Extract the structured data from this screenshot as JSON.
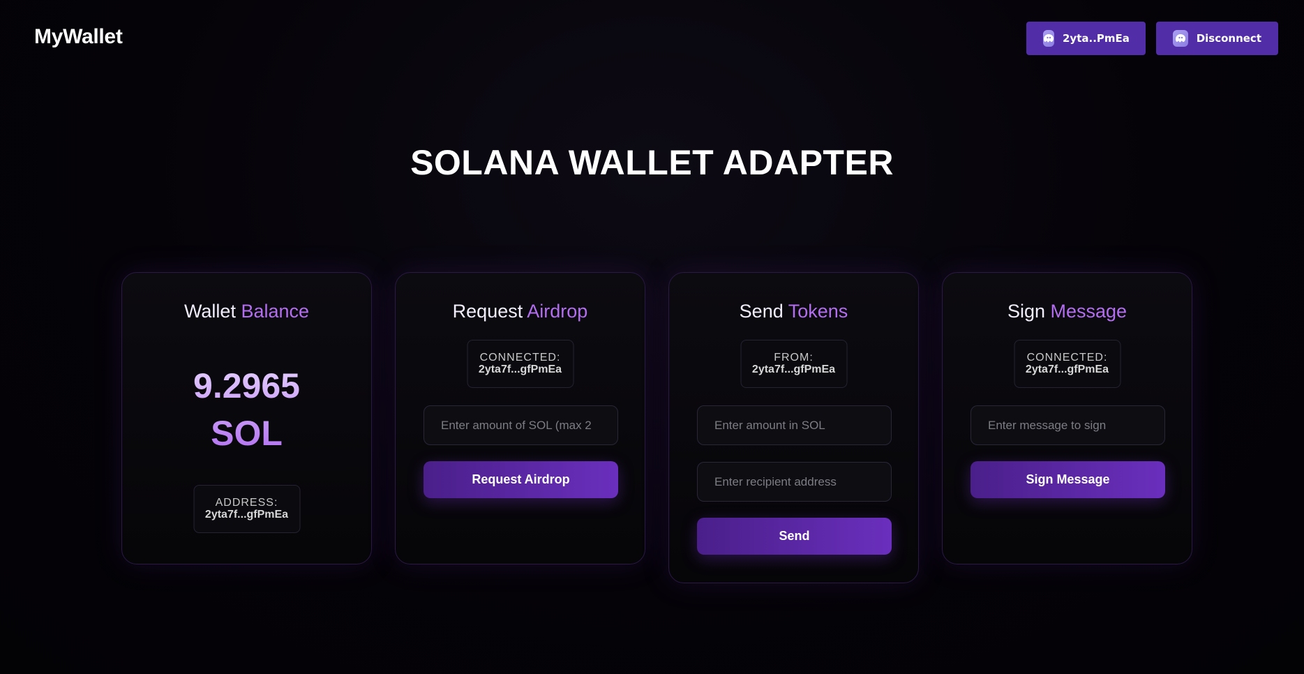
{
  "navbar": {
    "brand": "MyWallet",
    "address_button": "2yta..PmEa",
    "disconnect_button": "Disconnect"
  },
  "hero": {
    "title": "SOLANA WALLET ADAPTER"
  },
  "cards": {
    "balance": {
      "title_main": "Wallet",
      "title_accent": "Balance",
      "amount": "9.2965",
      "unit": "SOL",
      "chip_label": "ADDRESS:",
      "chip_value": "2yta7f...gfPmEa"
    },
    "airdrop": {
      "title_main": "Request",
      "title_accent": "Airdrop",
      "chip_label": "CONNECTED:",
      "chip_value": "2yta7f...gfPmEa",
      "amount_placeholder": "Enter amount of SOL (max 2",
      "button": "Request Airdrop"
    },
    "send": {
      "title_main": "Send",
      "title_accent": "Tokens",
      "chip_label": "FROM:",
      "chip_value": "2yta7f...gfPmEa",
      "amount_placeholder": "Enter amount in SOL",
      "recipient_placeholder": "Enter recipient address",
      "button": "Send"
    },
    "sign": {
      "title_main": "Sign",
      "title_accent": "Message",
      "chip_label": "CONNECTED:",
      "chip_value": "2yta7f...gfPmEa",
      "message_placeholder": "Enter message to sign",
      "button": "Sign Message"
    }
  },
  "colors": {
    "accent": "#b36ef0",
    "button_primary": "#512da8",
    "action_gradient_start": "#4a1f8a",
    "action_gradient_end": "#6a2fbd",
    "background": "#050308"
  },
  "icons": {
    "wallet_icon": "phantom-ghost-icon"
  }
}
